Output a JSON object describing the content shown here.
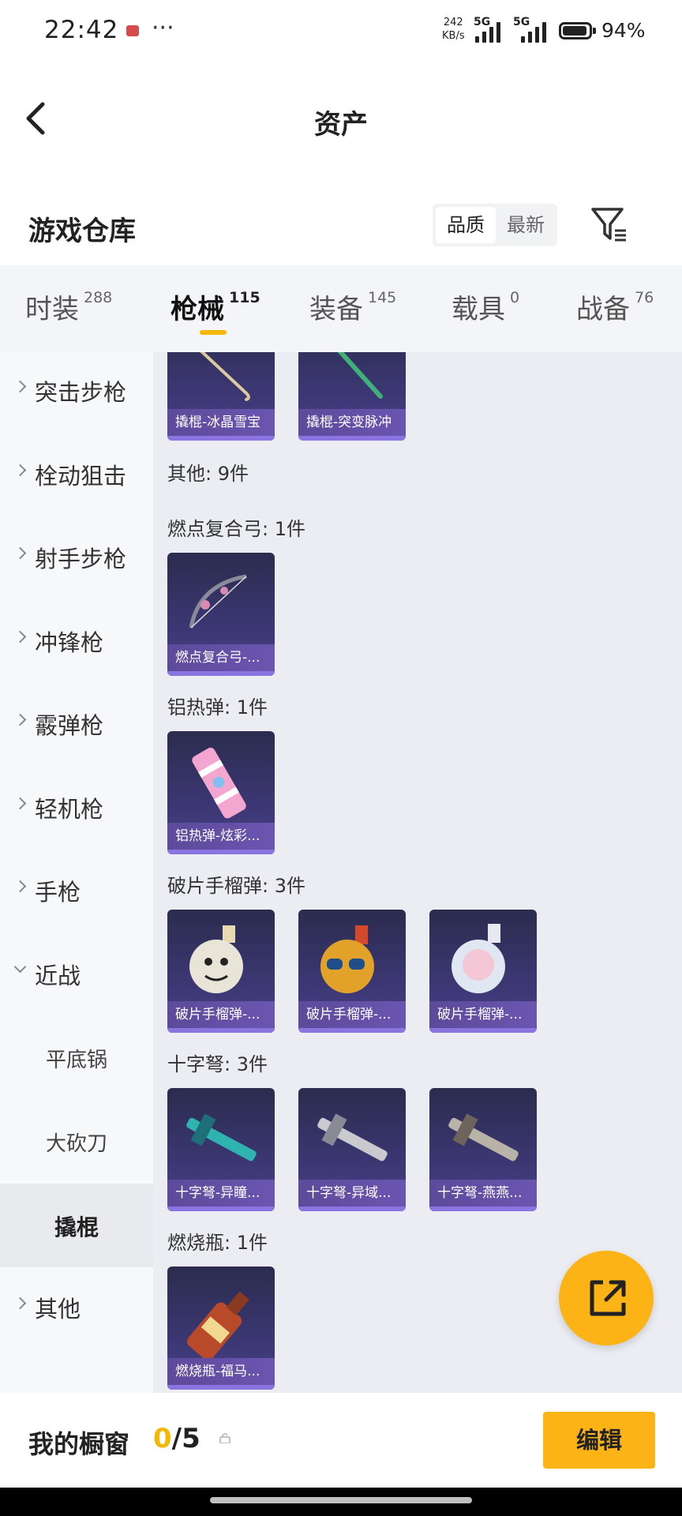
{
  "status_bar": {
    "time": "22:42",
    "more": "···",
    "net_speed": "242",
    "net_unit": "KB/s",
    "sim1": "5G",
    "sim2": "5G",
    "battery_level": 0.94,
    "battery_pct": "94%"
  },
  "header": {
    "title": "资产"
  },
  "warehouse": {
    "title": "游戏仓库",
    "sort_options": [
      "品质",
      "最新"
    ],
    "sort_selected": "品质"
  },
  "tabs": [
    {
      "label": "时装",
      "count": "288"
    },
    {
      "label": "枪械",
      "count": "115",
      "active": true
    },
    {
      "label": "装备",
      "count": "145"
    },
    {
      "label": "载具",
      "count": "0"
    },
    {
      "label": "战备",
      "count": "76"
    }
  ],
  "sidebar": {
    "items": [
      {
        "label": "突击步枪"
      },
      {
        "label": "栓动狙击"
      },
      {
        "label": "射手步枪"
      },
      {
        "label": "冲锋枪"
      },
      {
        "label": "霰弹枪"
      },
      {
        "label": "轻机枪"
      },
      {
        "label": "手枪"
      },
      {
        "label": "近战",
        "expanded": true
      },
      {
        "label": "平底锅"
      },
      {
        "label": "大砍刀"
      },
      {
        "label": "撬棍",
        "selected": true
      },
      {
        "label": "其他"
      }
    ]
  },
  "content": {
    "top_items": [
      "撬棍-冰晶雪宝",
      "撬棍-突变脉冲"
    ],
    "sections": [
      {
        "heading": "其他: 9件"
      },
      {
        "heading": "燃点复合弓: 1件",
        "items": [
          "燃点复合弓-..."
        ]
      },
      {
        "heading": "铝热弹: 1件",
        "items": [
          "铝热弹-炫彩..."
        ]
      },
      {
        "heading": "破片手榴弹: 3件",
        "items": [
          "破片手榴弹-...",
          "破片手榴弹-...",
          "破片手榴弹-..."
        ]
      },
      {
        "heading": "十字弩: 3件",
        "items": [
          "十字弩-异瞳...",
          "十字弩-异域...",
          "十字弩-燕燕..."
        ]
      },
      {
        "heading": "燃烧瓶: 1件",
        "items": [
          "燃烧瓶-福马..."
        ]
      }
    ]
  },
  "showcase": {
    "label": "我的橱窗",
    "current": "0",
    "sep_total": "/5",
    "edit_label": "编辑"
  },
  "colors": {
    "accent": "#fbb315",
    "card_bg": "#3a3670",
    "caption": "#6a56b0"
  },
  "icons": [
    "back-icon",
    "filter-icon",
    "share-icon",
    "lock-icon",
    "chevron-right-icon",
    "chevron-down-icon"
  ]
}
